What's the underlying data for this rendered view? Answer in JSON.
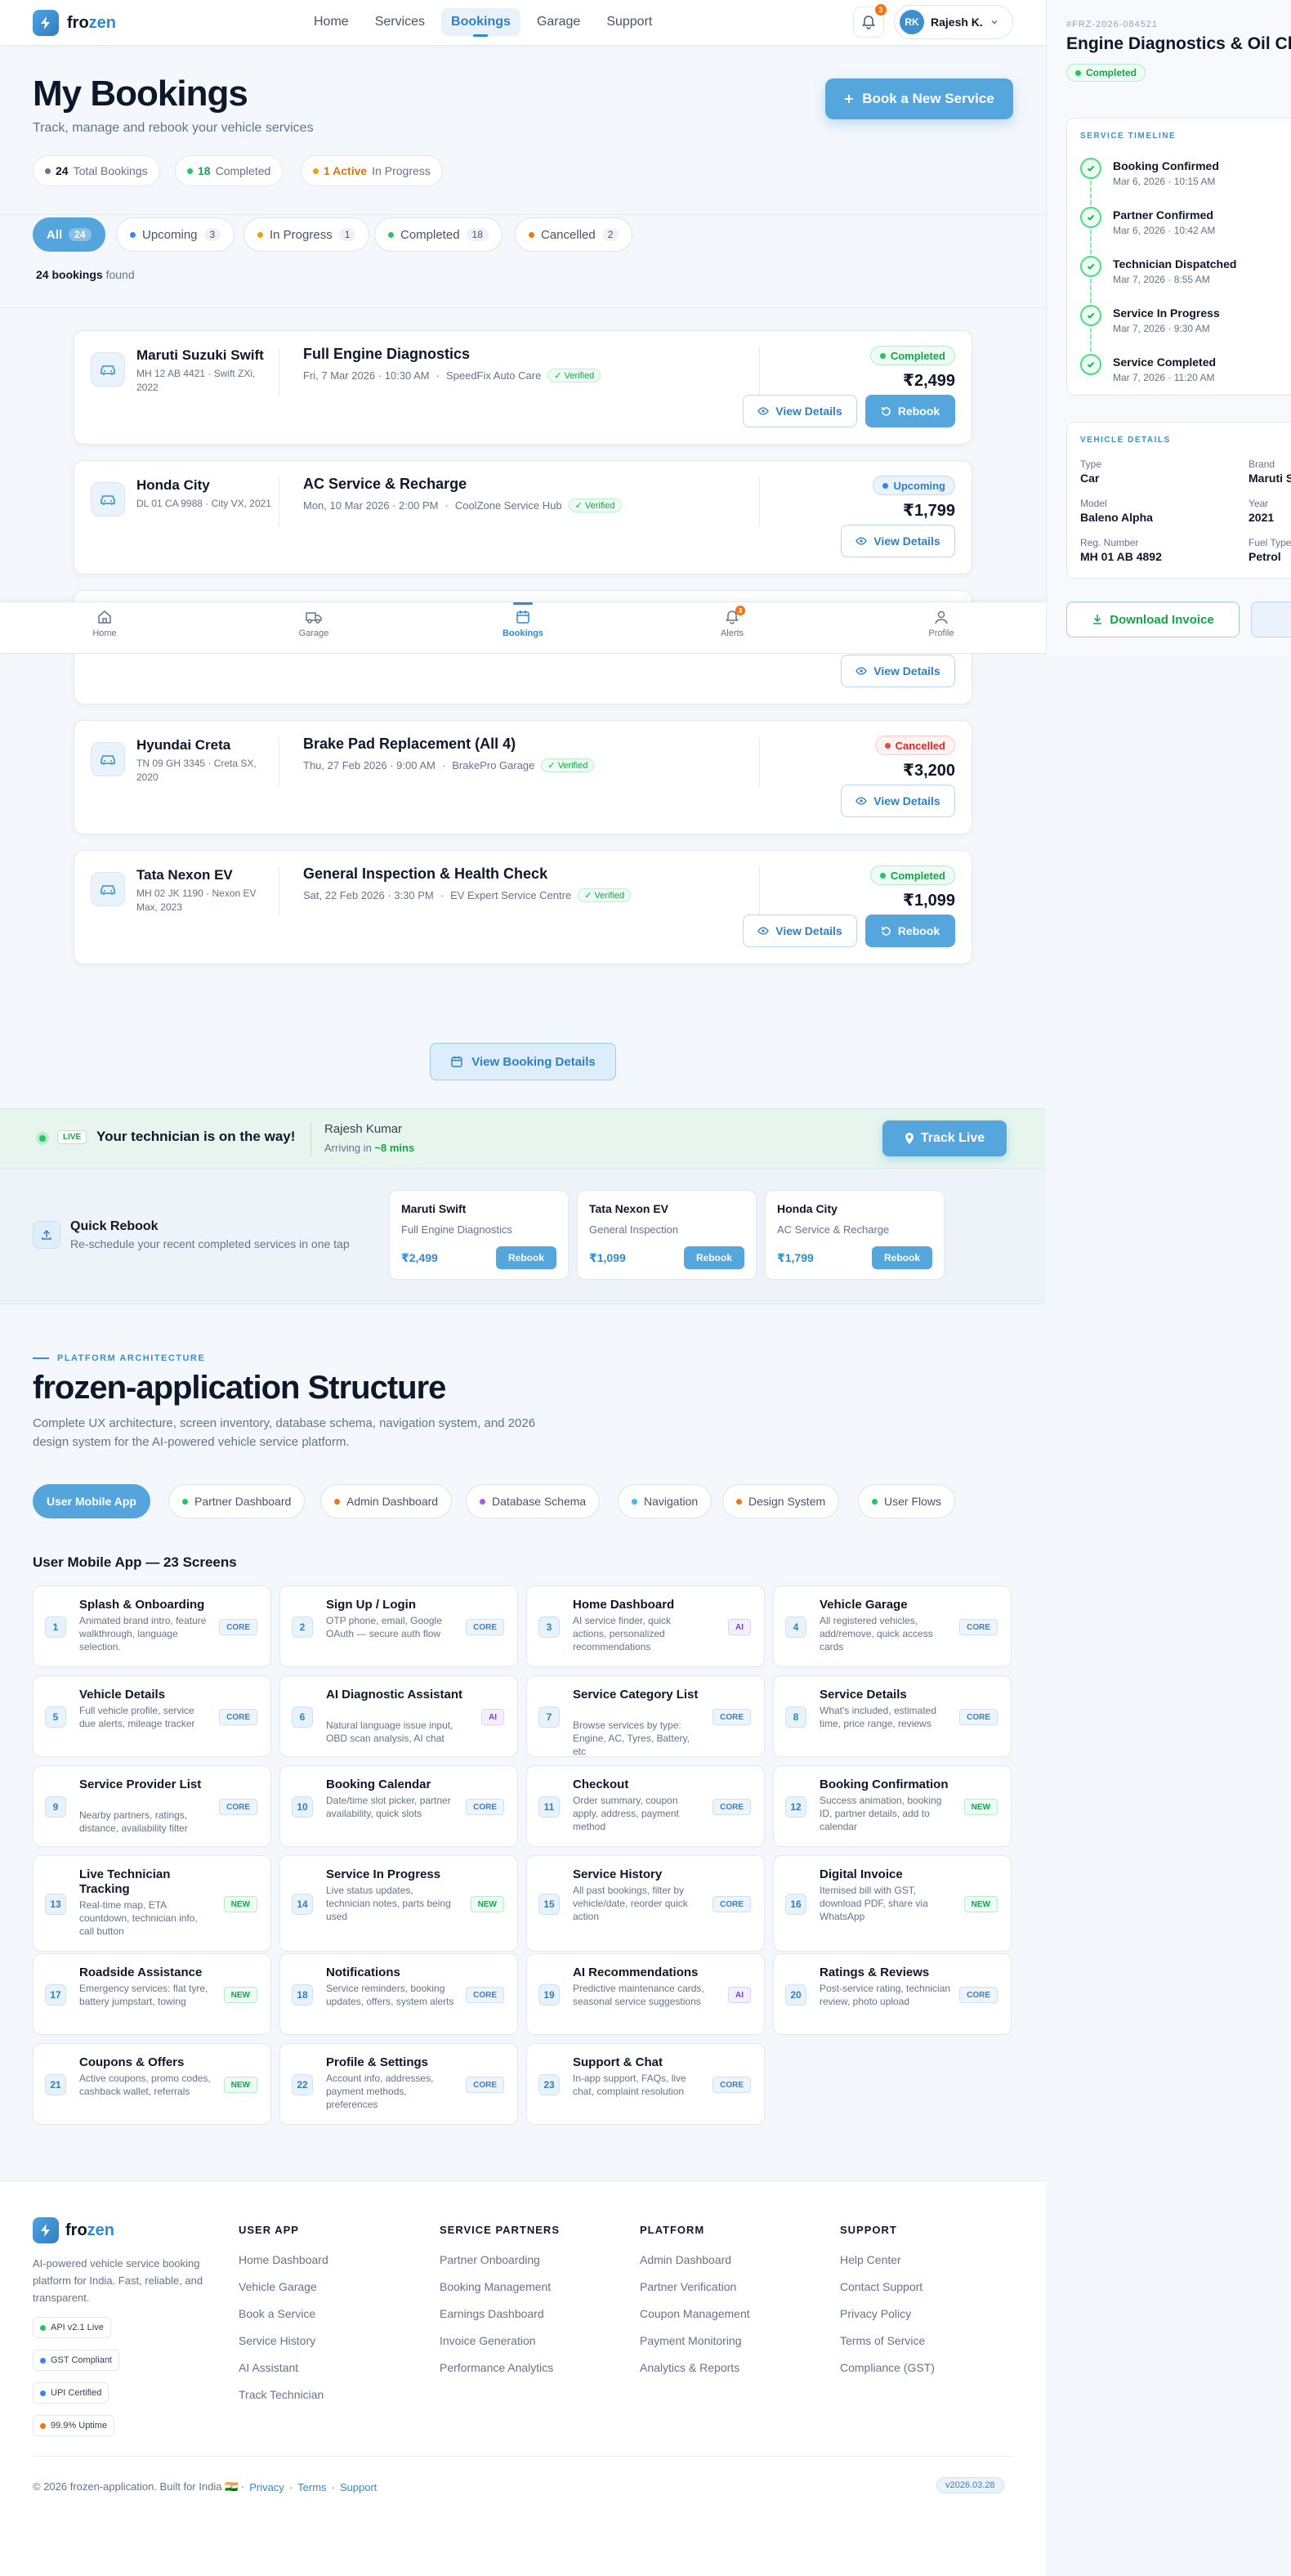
{
  "nav": {
    "brand_prefix": "fro",
    "brand_suffix": "zen",
    "links": [
      "Home",
      "Services",
      "Bookings",
      "Garage",
      "Support"
    ],
    "notif_count": "3",
    "user_initials": "RK",
    "user_name": "Rajesh K."
  },
  "header": {
    "title": "My Bookings",
    "subtitle": "Track, manage and rebook your vehicle services",
    "cta": "Book a New Service",
    "stats": [
      {
        "value": "24",
        "label": "Total Bookings",
        "color": "#64748b"
      },
      {
        "value": "18",
        "label": "Completed",
        "color": "#22c55e"
      },
      {
        "value": "1 Active",
        "label": "In Progress",
        "color": "#f59e0b"
      }
    ]
  },
  "filters": [
    {
      "label": "All",
      "count": "24",
      "color": ""
    },
    {
      "label": "Upcoming",
      "count": "3",
      "color": "#3b82f6"
    },
    {
      "label": "In Progress",
      "count": "1",
      "color": "#f59e0b"
    },
    {
      "label": "Completed",
      "count": "18",
      "color": "#22c55e"
    },
    {
      "label": "Cancelled",
      "count": "2",
      "color": "#f97316"
    }
  ],
  "found": {
    "count": "24 bookings",
    "suffix": "found"
  },
  "bookings": [
    {
      "car": "Maruti Suzuki Swift",
      "meta": "MH 12 AB 4421 · Swift ZXi, 2022",
      "service": "Full Engine Diagnostics",
      "date": "Fri, 7 Mar 2026 · 10:30 AM",
      "provider": "SpeedFix Auto Care",
      "verified": "Verified",
      "status": "Completed",
      "price": "₹2,499",
      "view": "View Details",
      "rebook": "Rebook"
    },
    {
      "car": "Honda City",
      "meta": "DL 01 CA 9988 · City VX, 2021",
      "service": "AC Service & Recharge",
      "date": "Mon, 10 Mar 2026 · 2:00 PM",
      "provider": "CoolZone Service Hub",
      "verified": "Verified",
      "status": "Upcoming",
      "price": "₹1,799",
      "view": "View Details"
    },
    {
      "view": "View Details"
    },
    {
      "car": "Hyundai Creta",
      "meta": "TN 09 GH 3345 · Creta SX, 2020",
      "service": "Brake Pad Replacement (All 4)",
      "date": "Thu, 27 Feb 2026 · 9:00 AM",
      "provider": "BrakePro Garage",
      "verified": "Verified",
      "status": "Cancelled",
      "price": "₹3,200",
      "view": "View Details"
    },
    {
      "car": "Tata Nexon EV",
      "meta": "MH 02 JK 1190 · Nexon EV Max, 2023",
      "service": "General Inspection & Health Check",
      "date": "Sat, 22 Feb 2026 · 3:30 PM",
      "provider": "EV Expert Service Centre",
      "verified": "Verified",
      "status": "Completed",
      "price": "₹1,099",
      "view": "View Details",
      "rebook": "Rebook"
    }
  ],
  "tabbar": {
    "items": [
      "Home",
      "Garage",
      "Bookings",
      "Alerts",
      "Profile"
    ],
    "alerts_count": "3"
  },
  "view_booking_details": "View Booking Details",
  "live": {
    "tag": "LIVE",
    "title": "Your technician is on the way!",
    "tech": "Rajesh Kumar",
    "eta_prefix": "Arriving in",
    "eta": "~8 mins",
    "cta": "Track Live"
  },
  "quick_rebook": {
    "title": "Quick Rebook",
    "subtitle": "Re-schedule your recent completed services in one tap",
    "items": [
      {
        "car": "Maruti Swift",
        "service": "Full Engine Diagnostics",
        "price": "₹2,499",
        "cta": "Rebook"
      },
      {
        "car": "Tata Nexon EV",
        "service": "General Inspection",
        "price": "₹1,099",
        "cta": "Rebook"
      },
      {
        "car": "Honda City",
        "service": "AC Service & Recharge",
        "price": "₹1,799",
        "cta": "Rebook"
      }
    ]
  },
  "architecture": {
    "eyebrow": "PLATFORM ARCHITECTURE",
    "title": "frozen-application Structure",
    "desc": "Complete UX architecture, screen inventory, database schema, navigation system, and 2026 design system for the AI-powered vehicle service platform.",
    "tabs": [
      {
        "label": "User Mobile App",
        "color": ""
      },
      {
        "label": "Partner Dashboard",
        "color": "#22c55e"
      },
      {
        "label": "Admin Dashboard",
        "color": "#f97316"
      },
      {
        "label": "Database Schema",
        "color": "#a855f7"
      },
      {
        "label": "Navigation",
        "color": "#38bdf8"
      },
      {
        "label": "Design System",
        "color": "#f97316"
      },
      {
        "label": "User Flows",
        "color": "#22c55e"
      }
    ],
    "section_title": "User Mobile App — 23 Screens",
    "screens": [
      {
        "n": "1",
        "title": "Splash & Onboarding",
        "desc": "Animated brand intro, feature walkthrough, language selection.",
        "tag": "CORE"
      },
      {
        "n": "2",
        "title": "Sign Up / Login",
        "desc": "OTP phone, email, Google OAuth — secure auth flow",
        "tag": "CORE"
      },
      {
        "n": "3",
        "title": "Home Dashboard",
        "desc": "AI service finder, quick actions, personalized recommendations",
        "tag": "AI"
      },
      {
        "n": "4",
        "title": "Vehicle Garage",
        "desc": "All registered vehicles, add/remove, quick access cards",
        "tag": "CORE"
      },
      {
        "n": "5",
        "title": "Vehicle Details",
        "desc": "Full vehicle profile, service due alerts, mileage tracker",
        "tag": "CORE"
      },
      {
        "n": "6",
        "title": "AI Diagnostic Assistant",
        "desc": "Natural language issue input, OBD scan analysis, AI chat",
        "tag": "AI"
      },
      {
        "n": "7",
        "title": "Service Category List",
        "desc": "Browse services by type: Engine, AC, Tyres, Battery, etc",
        "tag": "CORE"
      },
      {
        "n": "8",
        "title": "Service Details",
        "desc": "What's included, estimated time, price range, reviews",
        "tag": "CORE"
      },
      {
        "n": "9",
        "title": "Service Provider List",
        "desc": "Nearby partners, ratings, distance, availability filter",
        "tag": "CORE"
      },
      {
        "n": "10",
        "title": "Booking Calendar",
        "desc": "Date/time slot picker, partner availability, quick slots",
        "tag": "CORE"
      },
      {
        "n": "11",
        "title": "Checkout",
        "desc": "Order summary, coupon apply, address, payment method",
        "tag": "CORE"
      },
      {
        "n": "12",
        "title": "Booking Confirmation",
        "desc": "Success animation, booking ID, partner details, add to calendar",
        "tag": "NEW"
      },
      {
        "n": "13",
        "title": "Live Technician Tracking",
        "desc": "Real-time map, ETA countdown, technician info, call button",
        "tag": "NEW"
      },
      {
        "n": "14",
        "title": "Service In Progress",
        "desc": "Live status updates, technician notes, parts being used",
        "tag": "NEW"
      },
      {
        "n": "15",
        "title": "Service History",
        "desc": "All past bookings, filter by vehicle/date, reorder quick action",
        "tag": "CORE"
      },
      {
        "n": "16",
        "title": "Digital Invoice",
        "desc": "Itemised bill with GST, download PDF, share via WhatsApp",
        "tag": "NEW"
      },
      {
        "n": "17",
        "title": "Roadside Assistance",
        "desc": "Emergency services: flat tyre, battery jumpstart, towing",
        "tag": "NEW"
      },
      {
        "n": "18",
        "title": "Notifications",
        "desc": "Service reminders, booking updates, offers, system alerts",
        "tag": "CORE"
      },
      {
        "n": "19",
        "title": "AI Recommendations",
        "desc": "Predictive maintenance cards, seasonal service suggestions",
        "tag": "AI"
      },
      {
        "n": "20",
        "title": "Ratings & Reviews",
        "desc": "Post-service rating, technician review, photo upload",
        "tag": "CORE"
      },
      {
        "n": "21",
        "title": "Coupons & Offers",
        "desc": "Active coupons, promo codes, cashback wallet, referrals",
        "tag": "NEW"
      },
      {
        "n": "22",
        "title": "Profile & Settings",
        "desc": "Account info, addresses, payment methods, preferences",
        "tag": "CORE"
      },
      {
        "n": "23",
        "title": "Support & Chat",
        "desc": "In-app support, FAQs, live chat, complaint resolution",
        "tag": "CORE"
      }
    ]
  },
  "footer": {
    "desc": "AI-powered vehicle service booking platform for India. Fast, reliable, and transparent.",
    "badges": [
      {
        "label": "API v2.1 Live",
        "color": "#22c55e"
      },
      {
        "label": "GST Compliant",
        "color": "#3b82f6"
      },
      {
        "label": "UPI Certified",
        "color": "#3b82f6"
      },
      {
        "label": "99.9% Uptime",
        "color": "#f97316"
      }
    ],
    "columns": [
      {
        "title": "USER APP",
        "links": [
          "Home Dashboard",
          "Vehicle Garage",
          "Book a Service",
          "Service History",
          "AI Assistant",
          "Track Technician"
        ]
      },
      {
        "title": "SERVICE PARTNERS",
        "links": [
          "Partner Onboarding",
          "Booking Management",
          "Earnings Dashboard",
          "Invoice Generation",
          "Performance Analytics"
        ]
      },
      {
        "title": "PLATFORM",
        "links": [
          "Admin Dashboard",
          "Partner Verification",
          "Coupon Management",
          "Payment Monitoring",
          "Analytics & Reports"
        ]
      },
      {
        "title": "SUPPORT",
        "links": [
          "Help Center",
          "Contact Support",
          "Privacy Policy",
          "Terms of Service",
          "Compliance (GST)"
        ]
      }
    ],
    "copyright": "© 2026 frozen-application. Built for India 🇮🇳 ·",
    "links": [
      "Privacy",
      "Terms",
      "Support"
    ],
    "version": "v2026.03.28"
  },
  "detail_panel": {
    "id": "#FRZ-2026-084521",
    "title": "Engine Diagnostics & Oil Change",
    "status": "Completed",
    "timeline_label": "SERVICE TIMELINE",
    "timeline": [
      {
        "title": "Booking Confirmed",
        "time": "Mar 6, 2026 · 10:15 AM"
      },
      {
        "title": "Partner Confirmed",
        "time": "Mar 6, 2026 · 10:42 AM"
      },
      {
        "title": "Technician Dispatched",
        "time": "Mar 7, 2026 · 8:55 AM"
      },
      {
        "title": "Service In Progress",
        "time": "Mar 7, 2026 · 9:30 AM"
      },
      {
        "title": "Service Completed",
        "time": "Mar 7, 2026 · 11:20 AM"
      }
    ],
    "vehicle_label": "VEHICLE DETAILS",
    "vehicle": [
      {
        "k": "Type",
        "v": "Car"
      },
      {
        "k": "Brand",
        "v": "Maruti Suzuki"
      },
      {
        "k": "Model",
        "v": "Baleno Alpha"
      },
      {
        "k": "Year",
        "v": "2021"
      },
      {
        "k": "Reg. Number",
        "v": "MH 01 AB 4892"
      },
      {
        "k": "Fuel Type",
        "v": "Petrol"
      }
    ],
    "download": "Download Invoice"
  }
}
